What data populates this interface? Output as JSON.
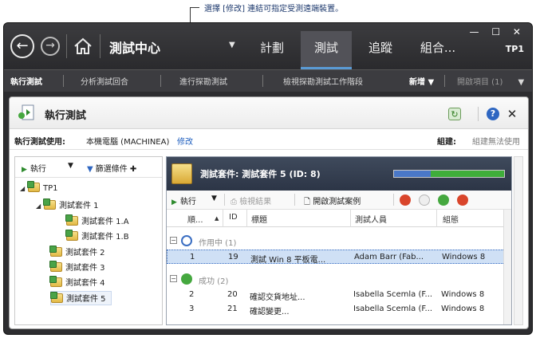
{
  "annotation": {
    "text": "選擇 [修改] 連結可指定受測遠端裝置。"
  },
  "topbar": {
    "title": "測試中心",
    "tabs": [
      "計劃",
      "測試",
      "追蹤",
      "組合..."
    ],
    "active_tab": "測試",
    "window_controls": "— ☐ ✕",
    "project": "TP1"
  },
  "subnav": {
    "items": [
      "執行測試",
      "分析測試回合",
      "進行探勘測試",
      "檢視探勘測試工作階段"
    ],
    "new_label": "新增",
    "open_items": "開啟項目 (1)"
  },
  "panel": {
    "title": "執行測試",
    "run_with_label": "執行測試使用:",
    "machine": "本機電腦 (MACHINEA)",
    "modify_link": "修改",
    "build_label": "組建:",
    "build_value": "組建無法使用"
  },
  "tree": {
    "run_label": "執行",
    "filter_label": "篩選條件",
    "nodes": [
      {
        "label": "TP1"
      },
      {
        "label": "測試套件 1"
      },
      {
        "label": "測試套件 1.A"
      },
      {
        "label": "測試套件 1.B"
      },
      {
        "label": "測試套件 2"
      },
      {
        "label": "測試套件 3"
      },
      {
        "label": "測試套件 4"
      },
      {
        "label": "測試套件 5"
      }
    ]
  },
  "grid": {
    "suite_title": "測試套件: 測試套件 5 (ID: 8)",
    "progress": {
      "blue": 0.33,
      "green": 0.67
    },
    "toolbar": {
      "run": "執行",
      "view_results": "檢視結果",
      "open_case": "開啟測試案例"
    },
    "columns": [
      "順...",
      "ID",
      "標題",
      "測試人員",
      "組態"
    ],
    "groups": [
      {
        "label": "作用中 (1)",
        "rows": [
          {
            "order": "1",
            "id": "19",
            "title": "測試 Win 8 平板電...",
            "tester": "Adam Barr (Fab...",
            "config": "Windows 8"
          }
        ]
      },
      {
        "label": "成功 (2)",
        "rows": [
          {
            "order": "2",
            "id": "20",
            "title": "確認交貨地址...",
            "tester": "Isabella Scemla (F...",
            "config": "Windows 8"
          },
          {
            "order": "3",
            "id": "21",
            "title": "確認變更...",
            "tester": "Isabella Scemla (F...",
            "config": "Windows 8"
          }
        ]
      }
    ]
  }
}
